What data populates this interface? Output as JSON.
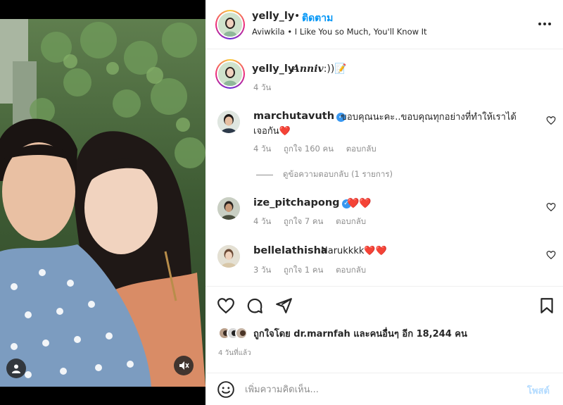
{
  "header": {
    "username": "yelly_ly",
    "dot": "•",
    "follow_label": "ติดตาม",
    "audio": "Aviwkila • I Like You so Much, You'll Know It",
    "more_icon": "more-horizontal-icon"
  },
  "caption": {
    "username": "yelly_ly",
    "text_script": "Anniv",
    "text_tail": ":))📝",
    "time": "4 วัน"
  },
  "comments": [
    {
      "username": "marchutavuth",
      "verified": true,
      "text": "ขอบคุณนะคะ..ขอบคุณทุกอย่างที่ทำให้เราได้เจอกัน❤️",
      "time": "4 วัน",
      "likes": "ถูกใจ 160 คน",
      "reply": "ตอบกลับ",
      "view_replies": "ดูข้อความตอบกลับ (1 รายการ)"
    },
    {
      "username": "ize_pitchapong",
      "verified": true,
      "text": "❤️❤️",
      "time": "4 วัน",
      "likes": "ถูกใจ 7 คน",
      "reply": "ตอบกลับ"
    },
    {
      "username": "bellelathisha",
      "verified": false,
      "text": "Narukkkk❤️❤️",
      "time": "3 วัน",
      "likes": "ถูกใจ 1 คน",
      "reply": "ตอบกลับ"
    }
  ],
  "actions": {
    "like_icon": "heart-icon",
    "comment_icon": "comment-icon",
    "share_icon": "send-icon",
    "save_icon": "bookmark-icon"
  },
  "likes_summary": "ถูกใจโดย dr.marnfah และคนอื่นๆ อีก 18,244 คน",
  "post_time": "4 วันที่แล้ว",
  "comment_box": {
    "placeholder": "เพิ่มความคิดเห็น...",
    "post_label": "โพสต์"
  },
  "colors": {
    "accent": "#0095f6",
    "post_disabled": "#b3dbff",
    "like_red": "#e0245e"
  }
}
